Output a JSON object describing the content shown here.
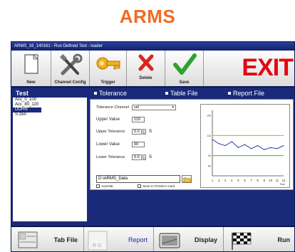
{
  "brand": "ARMS",
  "window": {
    "title": "ARMS_16_140161 - Run Defined Test - loader"
  },
  "toolbar": {
    "new_label": "New",
    "channel_config_label": "Channel Config",
    "trigger_label": "Trigger",
    "delete_label": "Delete",
    "save_label": "Save",
    "exit_label": "EXIT"
  },
  "test_list": {
    "header": "Test",
    "items": [
      "Acc_0_100",
      "Acc_80_120",
      "DOHN",
      "S-350"
    ],
    "selected": "DOHN"
  },
  "tabs": {
    "tolerance": "Tolerance",
    "table_file": "Table File",
    "report_file": "Report File"
  },
  "tolerance": {
    "channel_label": "Tolerance Channel",
    "channel_value": "vel",
    "upper_value_label": "Upper Value",
    "upper_value": "110",
    "upper_tolerance_label": "Upper Tolerance",
    "upper_tolerance": "0.0",
    "upper_tolerance_unit": "S",
    "lower_value_label": "Lower Value",
    "lower_value": "90",
    "lower_tolerance_label": "Lower Tolerance",
    "lower_tolerance": "0.0",
    "lower_tolerance_unit": "S",
    "path": "D:\\ARMS_Data",
    "autotab_label": "AutoTab",
    "pcmcia_label": "Store In PCMCIA Card"
  },
  "chart_data": {
    "type": "line",
    "x": [
      1,
      2,
      3,
      4,
      5,
      6,
      7,
      8,
      9,
      10,
      11,
      12
    ],
    "xticks": [
      "1",
      "2",
      "3",
      "4",
      "5",
      "6",
      "7",
      "8",
      "9",
      "10",
      "11",
      "12"
    ],
    "xlabel": "Time",
    "yticks": [
      "130",
      "110",
      "90",
      "80"
    ],
    "ylim": [
      70,
      135
    ],
    "upper_limit": 110,
    "lower_limit": 90,
    "series": [
      {
        "values": [
          106,
          102,
          100,
          104,
          98,
          101,
          97,
          100,
          96,
          98,
          97,
          100
        ]
      }
    ],
    "colors": {
      "series": "#1a2a9a",
      "upper": "#d7a000",
      "lower": "#2aa02a"
    }
  },
  "bottom_bar": {
    "tab_file_label": "Tab File",
    "report_label": "Report",
    "display_label": "Display",
    "run_label": "Run",
    "report_color": "#1a2aaa"
  }
}
